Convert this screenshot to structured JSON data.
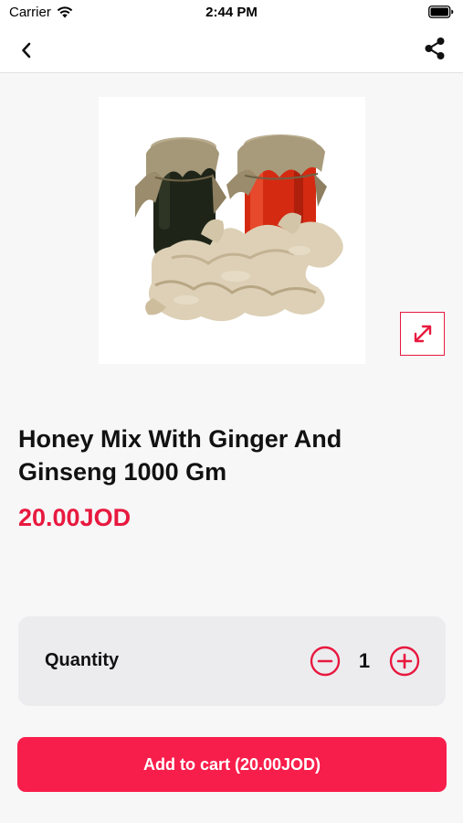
{
  "status_bar": {
    "carrier": "Carrier",
    "time": "2:44 PM"
  },
  "nav": {
    "back_icon": "chevron-left-icon",
    "share_icon": "share-icon"
  },
  "product": {
    "image_description_icon": "product-photo",
    "title": "Honey Mix With Ginger And Ginseng 1000 Gm",
    "price": "20.00JOD"
  },
  "quantity": {
    "label": "Quantity",
    "value": "1"
  },
  "cart": {
    "button_label": "Add to cart (20.00JOD)"
  },
  "colors": {
    "accent": "#e8193f",
    "button": "#f81e4b",
    "background": "#f7f7f8",
    "card": "#ececef"
  }
}
